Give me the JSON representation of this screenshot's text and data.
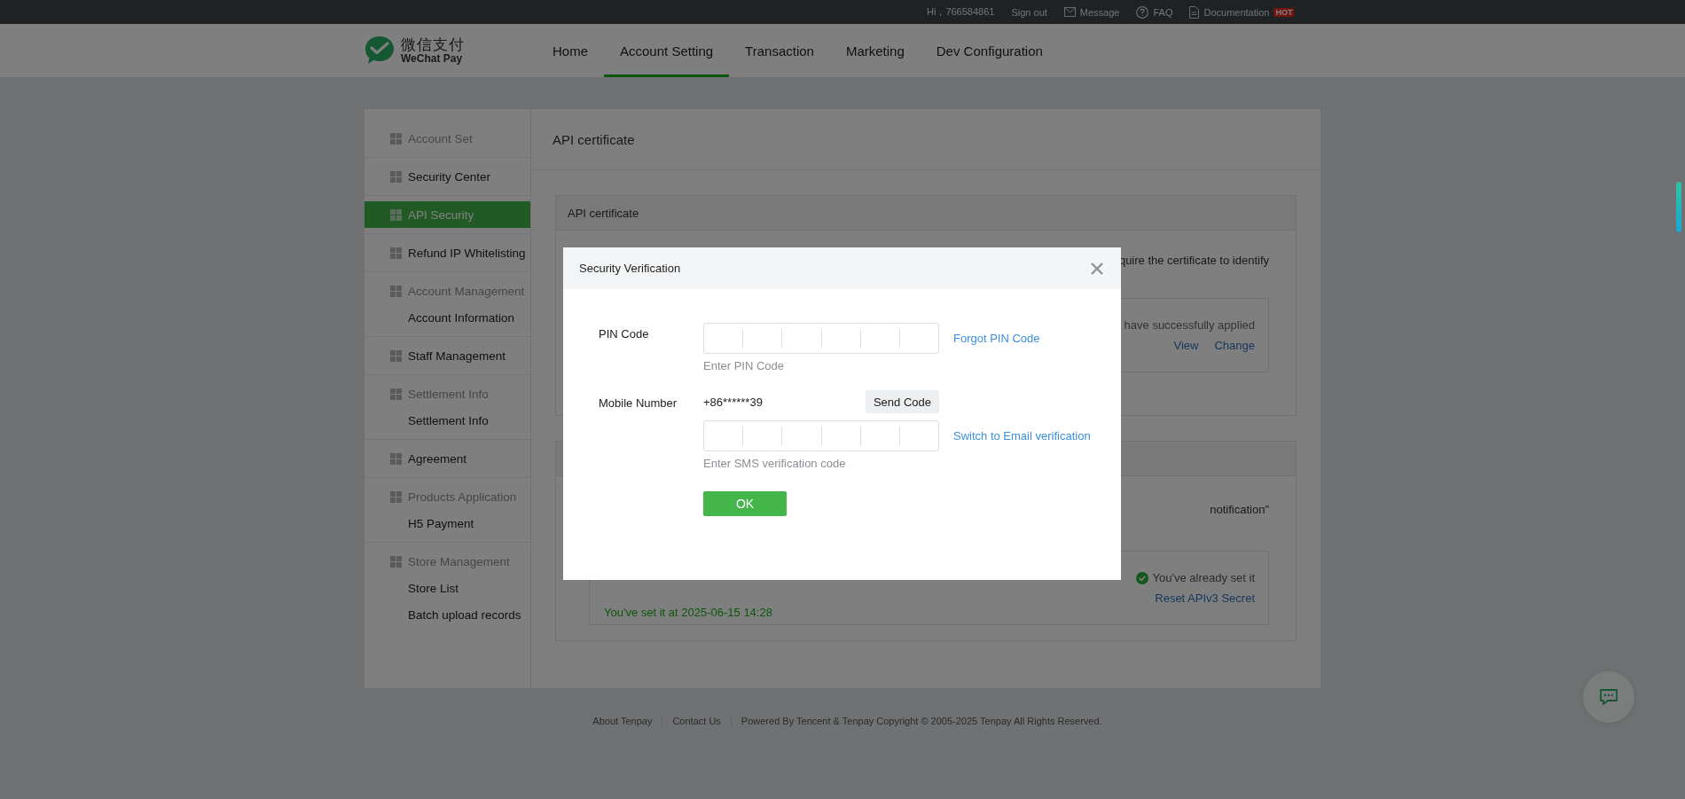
{
  "top_bar": {
    "greeting": "Hi，766584861",
    "links": [
      {
        "label": "Sign out",
        "kind": "plain"
      },
      {
        "label": "Message",
        "kind": "mail"
      },
      {
        "label": "FAQ",
        "kind": "help"
      },
      {
        "label": "Documentation",
        "kind": "doc",
        "badge": "HOT"
      }
    ]
  },
  "header": {
    "logo": {
      "name_cn": "微信支付",
      "name_en": "WeChat Pay"
    },
    "nav": [
      {
        "label": "Home",
        "selected": false
      },
      {
        "label": "Account Setting",
        "selected": true
      },
      {
        "label": "Transaction",
        "selected": false
      },
      {
        "label": "Marketing",
        "selected": false
      },
      {
        "label": "Dev Configuration",
        "selected": false
      }
    ]
  },
  "sidebar": {
    "sections": [
      {
        "label": "Account Set",
        "kind": "group",
        "selected": false
      },
      {
        "label": "Security Center",
        "kind": "item",
        "selected": false
      },
      {
        "label": "API Security",
        "kind": "item",
        "selected": true
      },
      {
        "label": "Refund IP Whitelisting",
        "kind": "item",
        "selected": false
      },
      {
        "label": "Account Management",
        "kind": "group",
        "selected": false,
        "children": [
          {
            "label": "Account Information"
          }
        ]
      },
      {
        "label": "Staff Management",
        "kind": "item",
        "selected": false
      },
      {
        "label": "Settlement Info",
        "kind": "group",
        "selected": false,
        "children": [
          {
            "label": "Settlement Info"
          }
        ]
      },
      {
        "label": "Agreement",
        "kind": "item",
        "selected": false
      },
      {
        "label": "Products Application",
        "kind": "group",
        "selected": false,
        "children": [
          {
            "label": "H5 Payment"
          }
        ]
      },
      {
        "label": "Store Management",
        "kind": "group",
        "selected": false,
        "children": [
          {
            "label": "Store List"
          },
          {
            "label": "Batch upload records"
          }
        ]
      }
    ]
  },
  "content": {
    "title": "API certificate",
    "panels": [
      {
        "title": "API certificate",
        "text": "quire the certificate to identify",
        "box": {
          "note": "have successfully applied",
          "links": [
            "View",
            "Change"
          ]
        }
      },
      {
        "text": "notification\"",
        "box": {
          "status": "You've already set it",
          "set_time": "You've set it at 2025-06-15 14:28",
          "links": [
            "Reset APIv3 Secret"
          ]
        }
      }
    ]
  },
  "modal": {
    "title": "Security Verification",
    "fields": [
      {
        "label": "PIN Code",
        "kind": "code",
        "hint": "Enter PIN Code",
        "link": "Forgot PIN Code"
      },
      {
        "label": "Mobile Number",
        "kind": "sms",
        "phone": "+86******39",
        "send_button": "Send Code",
        "hint": "Enter SMS verification code",
        "link": "Switch to Email verification"
      }
    ],
    "ok_button": "OK"
  },
  "footer": {
    "links": [
      "About Tenpay",
      "Contact Us"
    ],
    "copyright": "Powered By Tencent & Tenpay Copyright © 2005-2025 Tenpay All Rights Reserved."
  }
}
